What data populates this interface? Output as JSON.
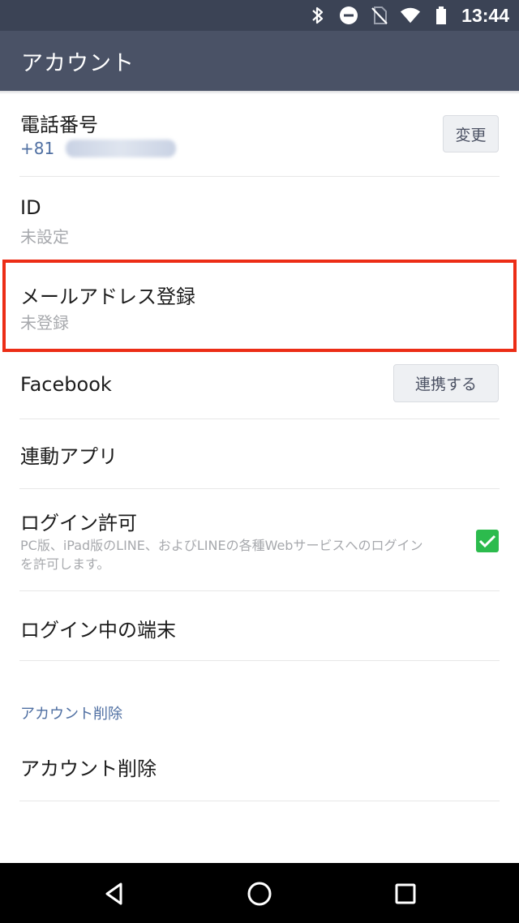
{
  "status_bar": {
    "time": "13:44",
    "icons": [
      "bluetooth-icon",
      "do-not-disturb-icon",
      "no-sim-icon",
      "wifi-icon",
      "battery-icon"
    ]
  },
  "app_bar": {
    "title": "アカウント"
  },
  "rows": {
    "phone": {
      "title": "電話番号",
      "country_code": "+81",
      "button": "変更"
    },
    "id": {
      "title": "ID",
      "value": "未設定"
    },
    "email": {
      "title": "メールアドレス登録",
      "value": "未登録"
    },
    "facebook": {
      "title": "Facebook",
      "button": "連携する"
    },
    "linked_apps": {
      "title": "連動アプリ"
    },
    "login_permission": {
      "title": "ログイン許可",
      "description": "PC版、iPad版のLINE、およびLINEの各種Webサービスへのログインを許可します。",
      "checked": true
    },
    "devices": {
      "title": "ログイン中の端末"
    }
  },
  "section": {
    "header": "アカウント削除",
    "delete_title": "アカウント削除"
  },
  "colors": {
    "status_bar": "#3b4355",
    "app_bar": "#4a5266",
    "accent_blue": "#4f6fa2",
    "highlight_red": "#ec2d16",
    "checkbox_green": "#2cbb4d"
  },
  "nav_bar": {
    "icons": [
      "back-triangle-icon",
      "home-circle-icon",
      "recents-square-icon"
    ]
  }
}
